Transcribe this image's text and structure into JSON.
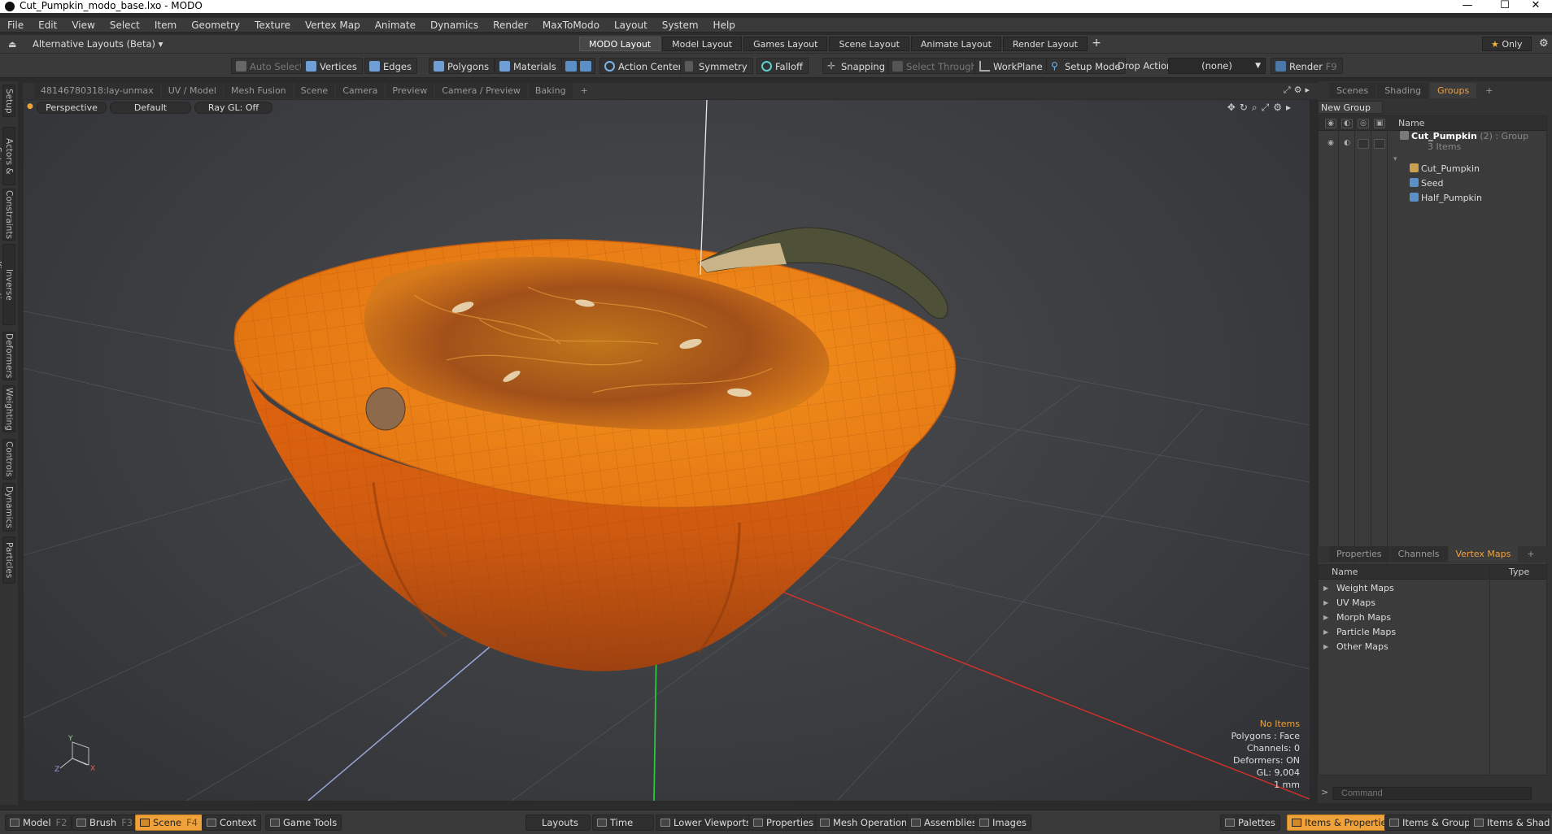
{
  "window": {
    "title": "Cut_Pumpkin_modo_base.lxo - MODO",
    "minimize": "—",
    "maximize": "☐",
    "close": "✕"
  },
  "menu": [
    "File",
    "Edit",
    "View",
    "Select",
    "Item",
    "Geometry",
    "Texture",
    "Vertex Map",
    "Animate",
    "Dynamics",
    "Render",
    "MaxToModo",
    "Layout",
    "System",
    "Help"
  ],
  "layouts": {
    "alternative": "Alternative Layouts (Beta) ▾",
    "tabs": [
      "MODO Layout",
      "Model Layout",
      "Games Layout",
      "Scene Layout",
      "Animate Layout",
      "Render Layout"
    ],
    "active_tab": 0,
    "only": "Only"
  },
  "toolbar": {
    "auto_select": "Auto Select",
    "vertices": "Vertices",
    "edges": "Edges",
    "polygons": "Polygons",
    "materials": "Materials",
    "action_center": "Action Center",
    "symmetry": "Symmetry",
    "falloff": "Falloff",
    "snapping": "Snapping",
    "select_through": "Select Through",
    "workplane": "WorkPlane",
    "setup_mode": "Setup Mode",
    "drop_action": "Drop Action",
    "drop_value": "(none)",
    "render": "Render",
    "render_key": "F9"
  },
  "left_tabs": [
    "Setup",
    "Actors & Sets",
    "Constraints",
    "Inverse Kinematics",
    "Deformers",
    "Weighting",
    "Controls",
    "Dynamics",
    "Particles"
  ],
  "viewport_tabs": [
    "48146780318:lay-unmax",
    "UV / Model",
    "Mesh Fusion",
    "Scene",
    "Camera",
    "Preview",
    "Camera / Preview",
    "Baking"
  ],
  "viewport": {
    "perspective": "Perspective",
    "default": "Default",
    "raygl": "Ray GL: Off",
    "info": {
      "items": "No Items",
      "polygons": "Polygons : Face",
      "channels": "Channels: 0",
      "deformers": "Deformers: ON",
      "gl": "GL: 9,004",
      "unit": "1 mm"
    },
    "axis": {
      "y": "Y",
      "x": "X",
      "z": "Z"
    }
  },
  "right_top_tabs": [
    "Scenes",
    "Shading",
    "Groups"
  ],
  "groups": {
    "new_group": "New Group",
    "col_name": "Name",
    "root_name": "Cut_Pumpkin",
    "root_count": "(2)",
    "root_type": ": Group",
    "root_items": "3 Items",
    "children": [
      "Cut_Pumpkin",
      "Seed",
      "Half_Pumpkin"
    ]
  },
  "right_bottom_tabs": [
    "Properties",
    "Channels",
    "Vertex Maps"
  ],
  "vertex_maps": {
    "col_name": "Name",
    "col_type": "Type",
    "rows": [
      "Weight Maps",
      "UV Maps",
      "Morph Maps",
      "Particle Maps",
      "Other Maps"
    ]
  },
  "command": {
    "placeholder": "Command",
    "arrow": ">"
  },
  "bottom": {
    "model": "Model",
    "model_key": "F2",
    "brush": "Brush",
    "brush_key": "F3",
    "scene": "Scene",
    "scene_key": "F4",
    "context": "Context",
    "game_tools": "Game Tools",
    "layouts": "Layouts",
    "time": "Time",
    "lower_viewports": "Lower Viewports",
    "properties": "Properties",
    "mesh_operations": "Mesh Operations",
    "assemblies": "Assemblies",
    "images": "Images",
    "palettes": "Palettes",
    "items_properties": "Items & Properties",
    "items_groups": "Items & Groups",
    "items_shading": "Items & Shading"
  },
  "colors": {
    "accent": "#f0a23a",
    "pumpkin": "#e06a12",
    "pumpkin_dark": "#a84810",
    "flesh": "#f08a1c"
  }
}
